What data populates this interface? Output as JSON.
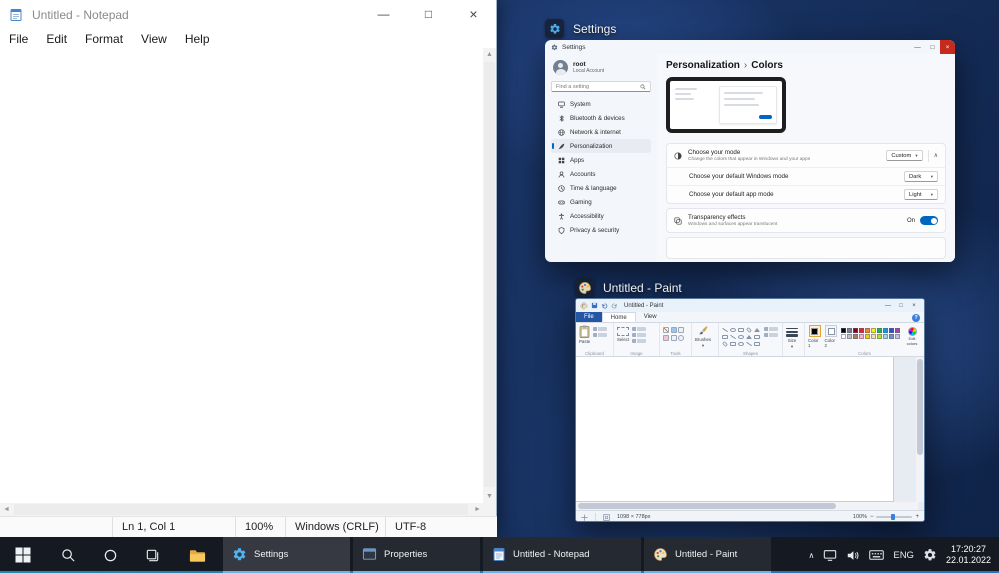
{
  "glyphs": {
    "minimize": "—",
    "maximize": "□",
    "close": "×",
    "dropdown": "▾",
    "collapse": "∧",
    "breadcrumb_sep": "›",
    "tray_chevron": "∧",
    "scroll_up": "▲",
    "scroll_down": "▼",
    "scroll_left": "◄",
    "scroll_right": "►",
    "help": "?",
    "zoom_out": "−",
    "zoom_in": "+"
  },
  "notepad": {
    "title": "Untitled - Notepad",
    "menu": [
      "File",
      "Edit",
      "Format",
      "View",
      "Help"
    ],
    "status_cursor": "Ln 1, Col 1",
    "status_zoom": "100%",
    "status_eol": "Windows (CRLF)",
    "status_encoding": "UTF-8"
  },
  "snap": {
    "settings_label": "Settings",
    "paint_label": "Untitled - Paint"
  },
  "settings": {
    "title": "Settings",
    "user_name": "root",
    "user_type": "Local Account",
    "search_placeholder": "Find a setting",
    "nav": [
      {
        "label": "System"
      },
      {
        "label": "Bluetooth & devices"
      },
      {
        "label": "Network & internet"
      },
      {
        "label": "Personalization"
      },
      {
        "label": "Apps"
      },
      {
        "label": "Accounts"
      },
      {
        "label": "Time & language"
      },
      {
        "label": "Gaming"
      },
      {
        "label": "Accessibility"
      },
      {
        "label": "Privacy & security"
      }
    ],
    "breadcrumb_parent": "Personalization",
    "breadcrumb_current": "Colors",
    "mode_title": "Choose your mode",
    "mode_subtitle": "Change the colors that appear in Windows and your apps",
    "mode_value": "Custom",
    "windows_mode_title": "Choose your default Windows mode",
    "windows_mode_value": "Dark",
    "app_mode_title": "Choose your default app mode",
    "app_mode_value": "Light",
    "transparency_title": "Transparency effects",
    "transparency_subtitle": "Windows and surfaces appear translucent",
    "transparency_value": "On",
    "accent_color": "#0067c0"
  },
  "paint": {
    "title": "Untitled - Paint",
    "tab_file": "File",
    "tab_home": "Home",
    "tab_view": "View",
    "paste_label": "Paste",
    "select_label": "Select",
    "brushes_label": "Brushes",
    "size_label": "Size",
    "color1_label": "Color 1",
    "color2_label": "Color 2",
    "edit_colors_label": "Edit colors",
    "group_clipboard": "Clipboard",
    "group_image": "Image",
    "group_tools": "Tools",
    "group_shapes": "Shapes",
    "group_colors": "Colors",
    "color1_value": "#000000",
    "color2_value": "#ffffff",
    "palette_row1": [
      "#000000",
      "#7f7f7f",
      "#880015",
      "#ed1c24",
      "#ff7f27",
      "#fff200",
      "#22b14c",
      "#00a2e8",
      "#3f48cc",
      "#a349a4"
    ],
    "palette_row2": [
      "#ffffff",
      "#c3c3c3",
      "#b97a57",
      "#ffaec9",
      "#ffc90e",
      "#efe4b0",
      "#b5e61d",
      "#99d9ea",
      "#7092be",
      "#c8bfe7"
    ],
    "status_size": "1098 × 778px",
    "status_zoom": "100%"
  },
  "taskbar": {
    "apps": [
      {
        "label": "Settings"
      },
      {
        "label": "Properties"
      },
      {
        "label": "Untitled - Notepad"
      },
      {
        "label": "Untitled - Paint"
      }
    ],
    "language": "ENG",
    "time": "17:20:27",
    "date": "22.01.2022"
  }
}
